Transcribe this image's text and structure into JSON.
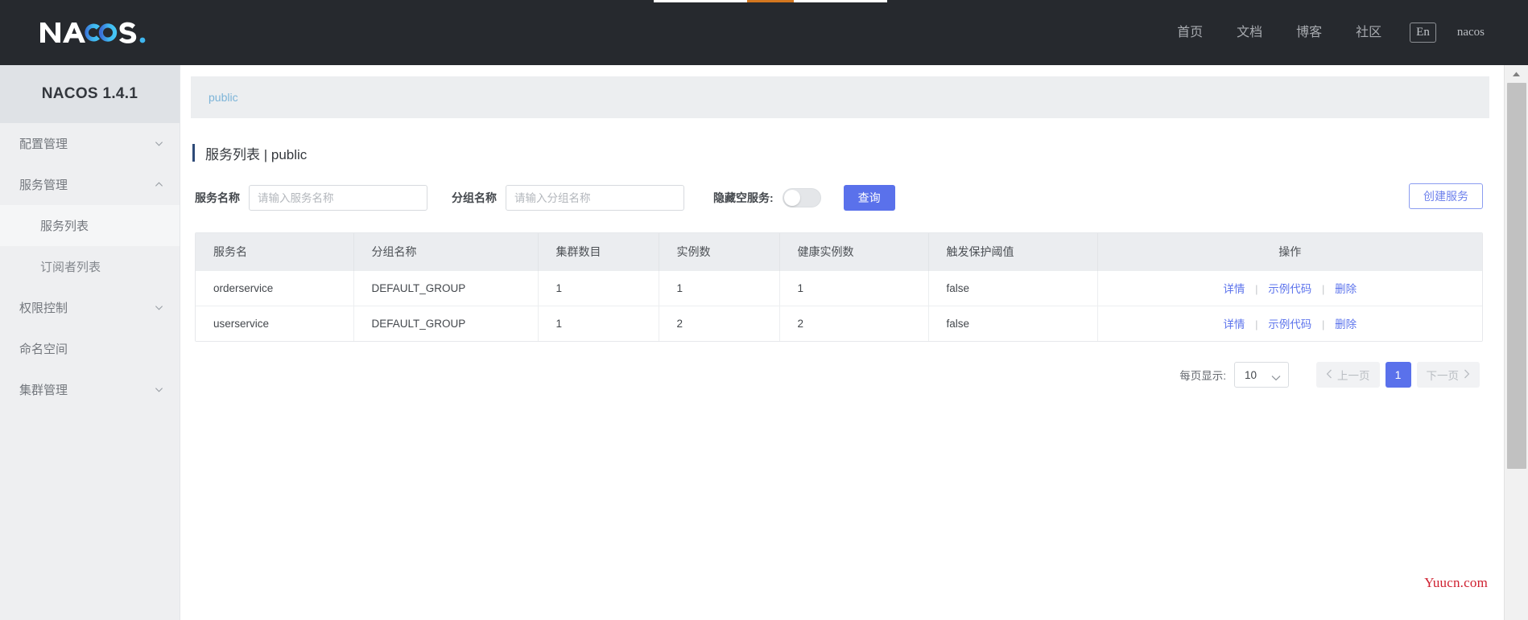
{
  "topnav": {
    "logo_text": "NACOS.",
    "links": [
      {
        "label": "首页"
      },
      {
        "label": "文档"
      },
      {
        "label": "博客"
      },
      {
        "label": "社区"
      }
    ],
    "lang_button": "En",
    "username": "nacos"
  },
  "sidebar": {
    "version_title": "NACOS 1.4.1",
    "items": [
      {
        "label": "配置管理",
        "chevron": "chevron-down",
        "expanded": false
      },
      {
        "label": "服务管理",
        "chevron": "chevron-up",
        "expanded": true
      },
      {
        "label": "服务列表",
        "sub": true,
        "active": true
      },
      {
        "label": "订阅者列表",
        "sub": true,
        "active": false
      },
      {
        "label": "权限控制",
        "chevron": "chevron-down",
        "expanded": false
      },
      {
        "label": "命名空间",
        "chevron": "none",
        "expanded": false
      },
      {
        "label": "集群管理",
        "chevron": "chevron-down",
        "expanded": false
      }
    ]
  },
  "breadcrumb": {
    "namespace": "public"
  },
  "page": {
    "title": "服务列表  |  public"
  },
  "filters": {
    "service_name_label": "服务名称",
    "service_name_placeholder": "请输入服务名称",
    "service_name_value": "",
    "group_name_label": "分组名称",
    "group_name_placeholder": "请输入分组名称",
    "group_name_value": "",
    "hide_empty_label": "隐藏空服务:",
    "hide_empty_state": "off",
    "query_button": "查询",
    "create_button": "创建服务"
  },
  "table": {
    "headers": [
      "服务名",
      "分组名称",
      "集群数目",
      "实例数",
      "健康实例数",
      "触发保护阈值",
      "操作"
    ],
    "actions": {
      "detail": "详情",
      "sample_code": "示例代码",
      "delete": "删除",
      "separator": "|"
    },
    "rows": [
      {
        "service_name": "orderservice",
        "group_name": "DEFAULT_GROUP",
        "cluster_count": "1",
        "instance_count": "1",
        "healthy_instance_count": "1",
        "protect_threshold": "false"
      },
      {
        "service_name": "userservice",
        "group_name": "DEFAULT_GROUP",
        "cluster_count": "1",
        "instance_count": "2",
        "healthy_instance_count": "2",
        "protect_threshold": "false"
      }
    ]
  },
  "pagination": {
    "per_page_label": "每页显示:",
    "per_page_value": "10",
    "prev_label": "上一页",
    "next_label": "下一页",
    "current_page": "1"
  },
  "watermark": {
    "text": "Yuucn.com"
  },
  "colors": {
    "nav_background": "#26292e",
    "sidebar_background": "#eeeff1",
    "primary_blue": "#5a71eb",
    "link_blue": "#5d74ec",
    "breadcrumb_blue": "#7cb4d8",
    "title_accent": "#2e4a78",
    "watermark_red": "#cf2030"
  }
}
